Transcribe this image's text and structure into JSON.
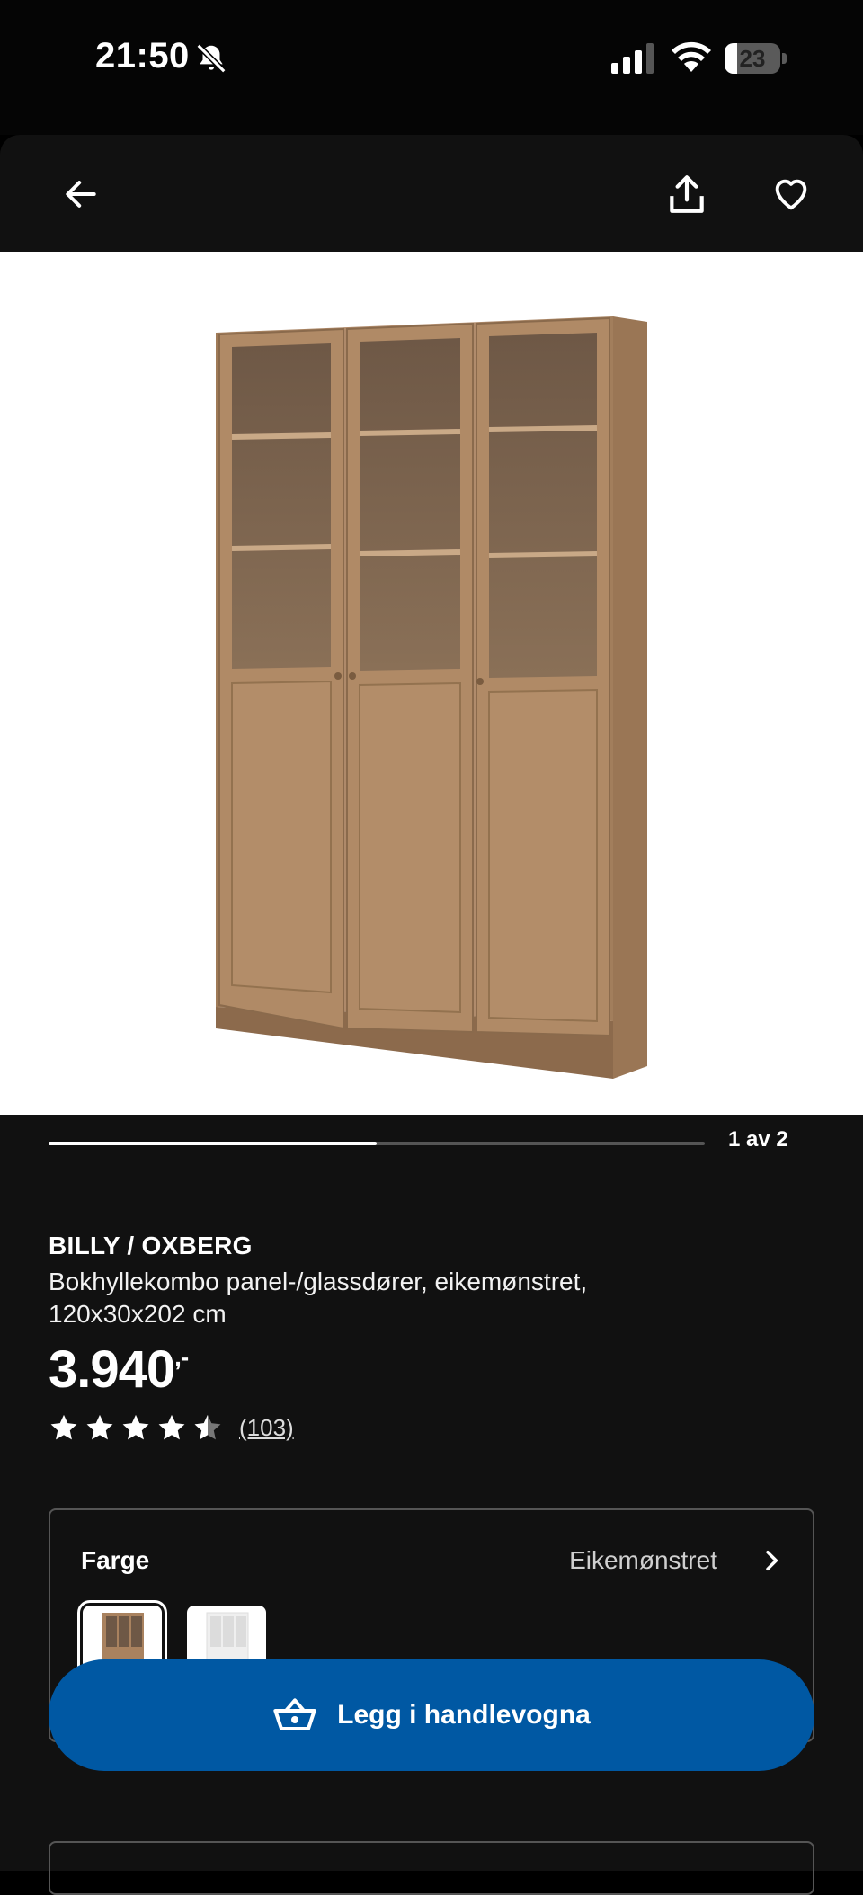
{
  "status_bar": {
    "time": "21:50",
    "battery": "23",
    "battery_level": 0.23,
    "icons": [
      "bell-slash-icon",
      "signal-icon",
      "wifi-icon",
      "battery-icon"
    ]
  },
  "nav": {
    "icons": [
      "arrow-left-icon",
      "share-icon",
      "heart-icon"
    ]
  },
  "gallery": {
    "page_indicator": "1 av 2",
    "progress": 0.5
  },
  "product": {
    "name": "BILLY / OXBERG",
    "description": "Bokhyllekombo panel-/glassdører, eikemønstret, 120x30x202 cm",
    "price": "3.940",
    "price_suffix": ",-",
    "rating": 4.5,
    "reviews": "(103)"
  },
  "color": {
    "label": "Farge",
    "value": "Eikemønstret",
    "swatches": [
      "oak-effect",
      "white"
    ]
  },
  "cart": {
    "label": "Legg i handlevogna",
    "color": "#0058a3"
  },
  "colors": {
    "background": "#111111",
    "accent": "#0058a3",
    "wood": "#b08a66"
  }
}
